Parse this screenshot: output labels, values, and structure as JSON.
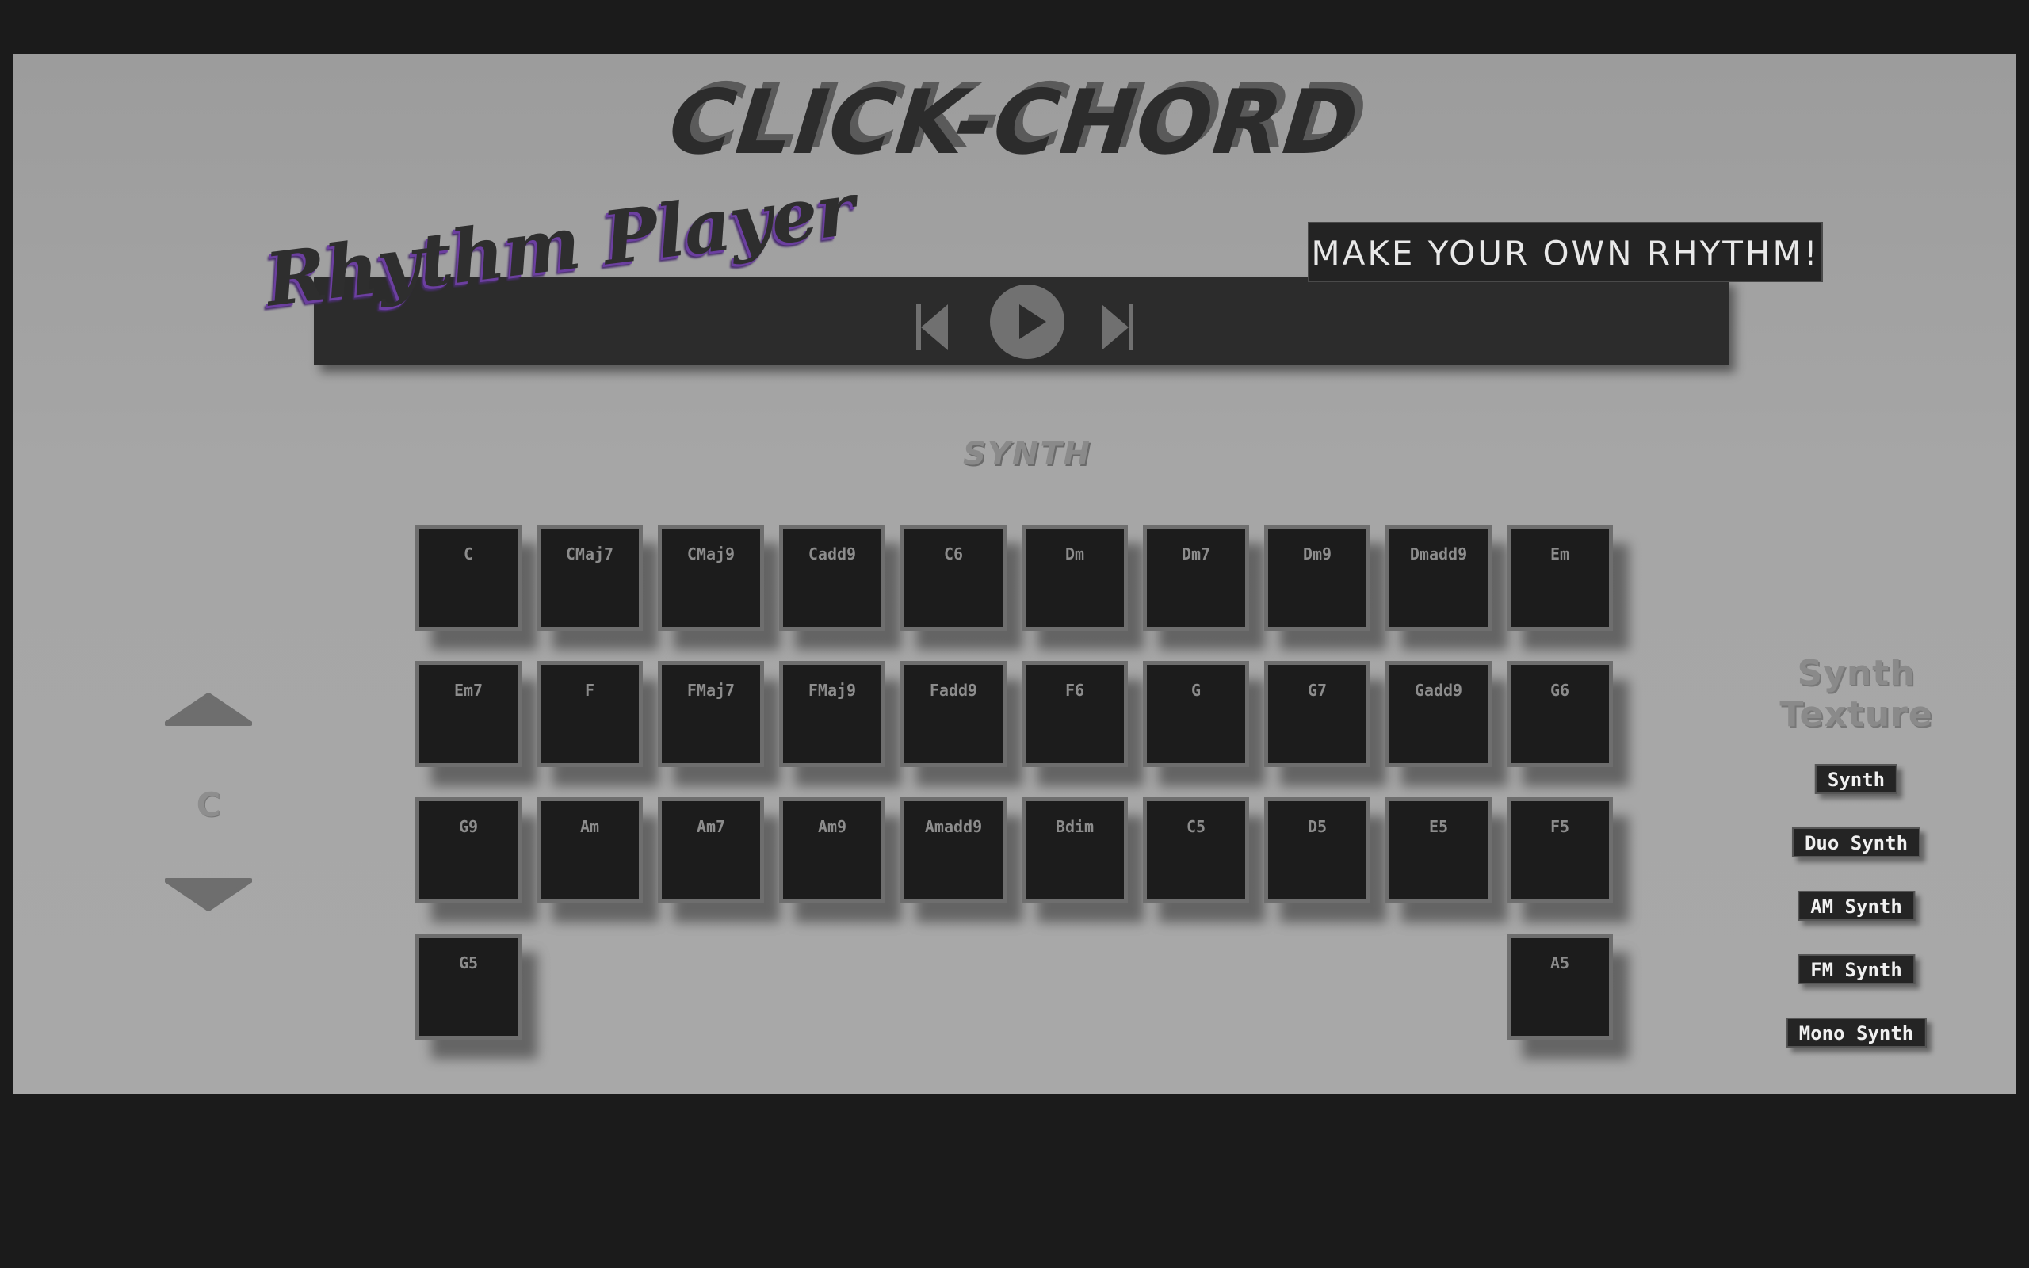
{
  "app": {
    "title": "CLICK-CHORD",
    "tagline": "MAKE YOUR OWN RHYTHM!"
  },
  "player": {
    "label": "Rhythm Player",
    "controls": [
      {
        "icon": "skip-back-icon"
      },
      {
        "icon": "play-icon"
      },
      {
        "icon": "skip-forward-icon"
      }
    ]
  },
  "section": {
    "title": "SYNTH"
  },
  "key_selector": {
    "current_key": "C",
    "up_icon": "arrow-up-icon",
    "down_icon": "arrow-down-icon"
  },
  "chords": {
    "rows": [
      [
        "C",
        "CMaj7",
        "CMaj9",
        "Cadd9",
        "C6",
        "Dm",
        "Dm7",
        "Dm9",
        "Dmadd9",
        "Em"
      ],
      [
        "Em7",
        "F",
        "FMaj7",
        "FMaj9",
        "Fadd9",
        "F6",
        "G",
        "G7",
        "Gadd9",
        "G6"
      ],
      [
        "G9",
        "Am",
        "Am7",
        "Am9",
        "Amadd9",
        "Bdim",
        "C5",
        "D5",
        "E5",
        "F5"
      ],
      [
        "G5",
        "A5"
      ]
    ]
  },
  "texture": {
    "title_line1": "Synth",
    "title_line2": "Texture",
    "options": [
      "Synth",
      "Duo Synth",
      "AM Synth",
      "FM Synth",
      "Mono Synth"
    ]
  },
  "colors": {
    "page_bg": "#1b1b1b",
    "panel_bg": "#a3a3a3",
    "tile_bg": "#1c1c1c",
    "tile_border": "#6e6e6e",
    "accent_purple": "#6c3fa0"
  }
}
